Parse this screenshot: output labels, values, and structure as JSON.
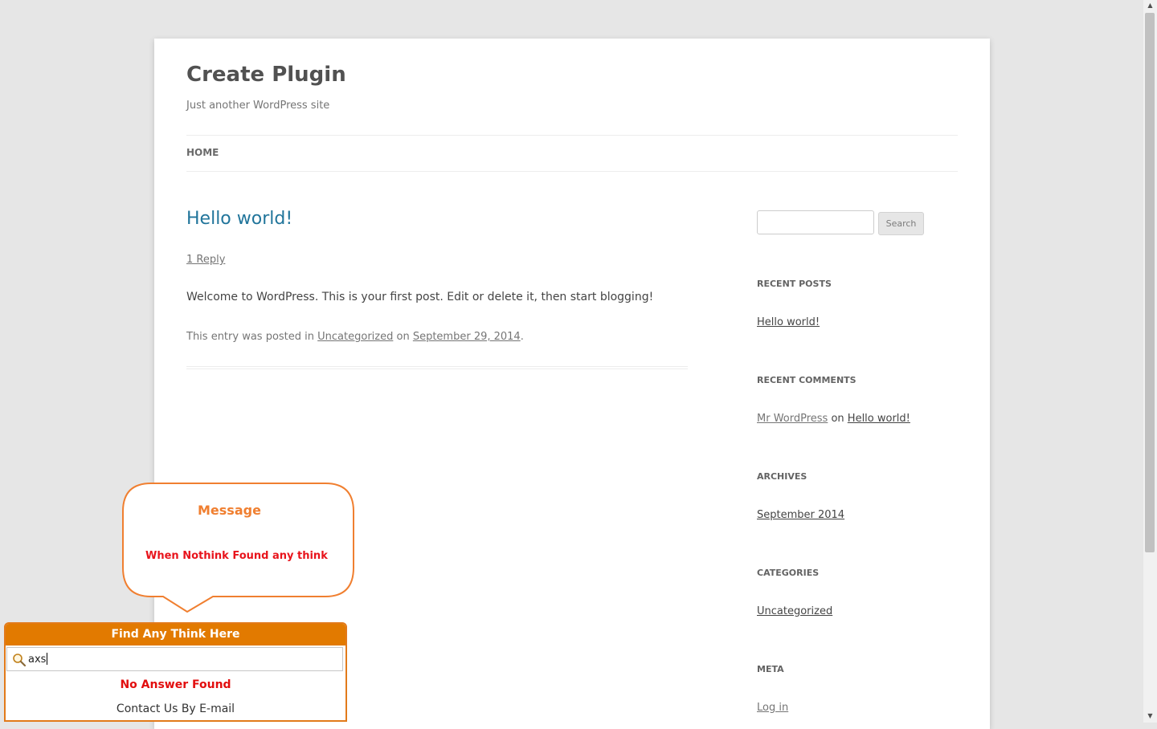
{
  "site": {
    "title": "Create Plugin",
    "description": "Just another WordPress site"
  },
  "nav": {
    "home_label": "HOME"
  },
  "post": {
    "title": "Hello world!",
    "reply_link": "1 Reply",
    "body": "Welcome to WordPress. This is your first post. Edit or delete it, then start blogging!",
    "meta_prefix": "This entry was posted in ",
    "category": "Uncategorized",
    "meta_on": " on ",
    "date": "September 29, 2014",
    "meta_suffix": "."
  },
  "sidebar": {
    "search_button": "Search",
    "search_value": "",
    "recent_posts": {
      "title": "RECENT POSTS",
      "items": [
        "Hello world!"
      ]
    },
    "recent_comments": {
      "title": "RECENT COMMENTS",
      "author": "Mr WordPress",
      "on": " on ",
      "post": "Hello world!"
    },
    "archives": {
      "title": "ARCHIVES",
      "items": [
        "September 2014"
      ]
    },
    "categories": {
      "title": "CATEGORIES",
      "items": [
        "Uncategorized"
      ]
    },
    "meta": {
      "title": "META",
      "items": [
        "Log in"
      ]
    }
  },
  "annotation": {
    "title": "Message",
    "text": "When Nothink Found any think"
  },
  "find_widget": {
    "header": "Find Any Think Here",
    "input_value": "axs",
    "status": "No Answer Found",
    "contact": "Contact Us By E-mail",
    "icon": "search-icon"
  },
  "colors": {
    "accent": "#e27a00",
    "link_blue": "#21759b",
    "error_red": "#e20e0e",
    "annotation_orange": "#f07f30"
  }
}
